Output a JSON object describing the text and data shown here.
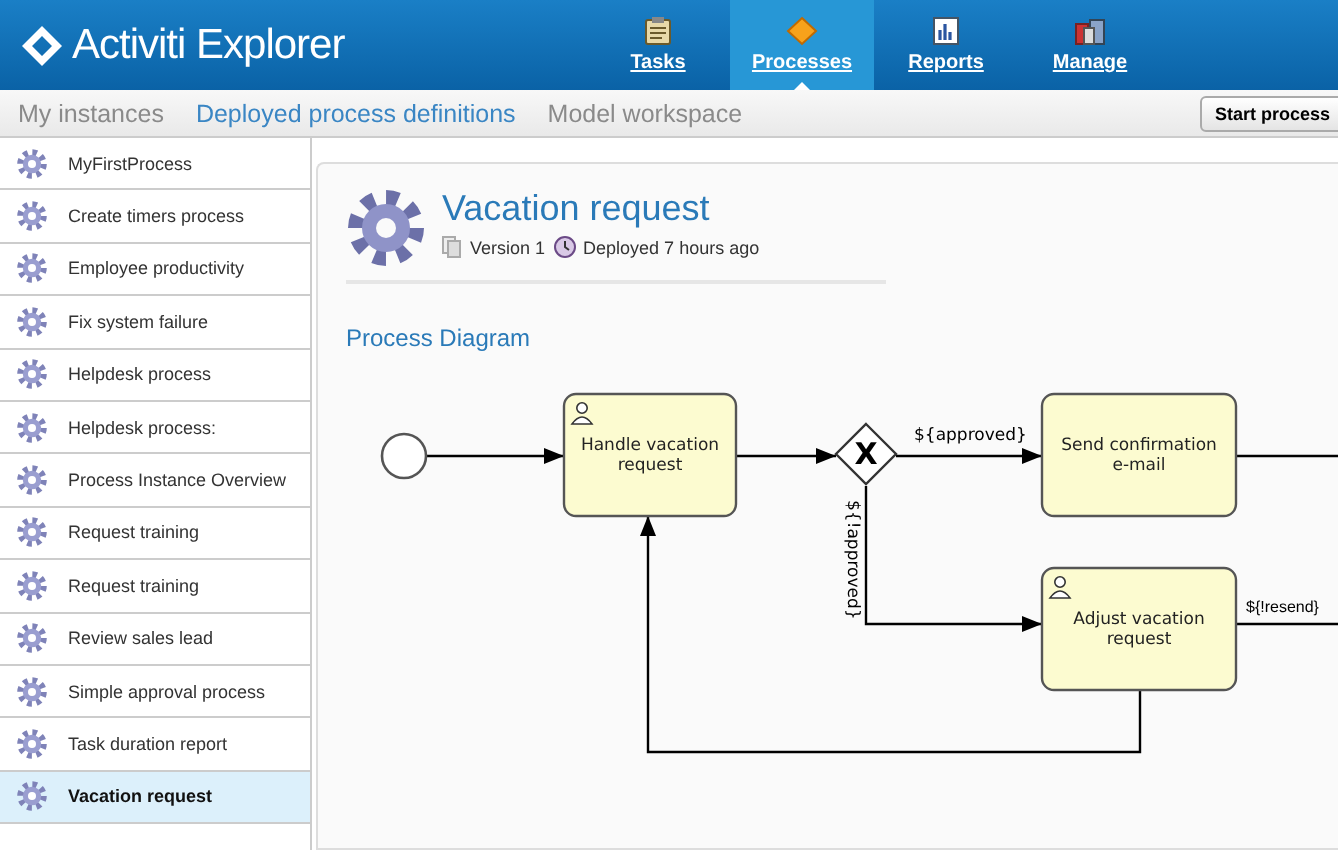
{
  "header": {
    "logo": "Activiti Explorer",
    "nav": [
      {
        "label": "Tasks",
        "kind": "tasks",
        "selected": false
      },
      {
        "label": "Processes",
        "kind": "processes",
        "selected": true
      },
      {
        "label": "Reports",
        "kind": "reports",
        "selected": false
      },
      {
        "label": "Manage",
        "kind": "manage",
        "selected": false
      }
    ]
  },
  "subtabs": [
    {
      "label": "My instances",
      "selected": false
    },
    {
      "label": "Deployed process definitions",
      "selected": true
    },
    {
      "label": "Model workspace",
      "selected": false
    }
  ],
  "start_button": "Start process",
  "sidebar": {
    "items": [
      {
        "label": "MyFirstProcess",
        "selected": false
      },
      {
        "label": "Create timers process",
        "selected": false
      },
      {
        "label": "Employee productivity",
        "selected": false
      },
      {
        "label": "Fix system failure",
        "selected": false
      },
      {
        "label": "Helpdesk process",
        "selected": false
      },
      {
        "label": "Helpdesk process:",
        "selected": false
      },
      {
        "label": "Process Instance Overview",
        "selected": false
      },
      {
        "label": "Request training",
        "selected": false
      },
      {
        "label": "Request training",
        "selected": false
      },
      {
        "label": "Review sales lead",
        "selected": false
      },
      {
        "label": "Simple approval process",
        "selected": false
      },
      {
        "label": "Task duration report",
        "selected": false
      },
      {
        "label": "Vacation request",
        "selected": true
      }
    ]
  },
  "detail": {
    "title": "Vacation request",
    "version": "Version 1",
    "deployed": "Deployed 7 hours ago",
    "section": "Process Diagram"
  },
  "diagram": {
    "nodes": [
      {
        "kind": "start"
      },
      {
        "kind": "user_task",
        "label": "Handle vacation request"
      },
      {
        "kind": "gateway",
        "label": "X"
      },
      {
        "kind": "service_task",
        "label": "Send confirmation e-mail"
      },
      {
        "kind": "user_task",
        "label": "Adjust vacation request"
      }
    ],
    "flows": [
      {
        "label": "${approved}"
      },
      {
        "label": "${!approved}"
      },
      {
        "label": "${!resend}"
      }
    ]
  }
}
